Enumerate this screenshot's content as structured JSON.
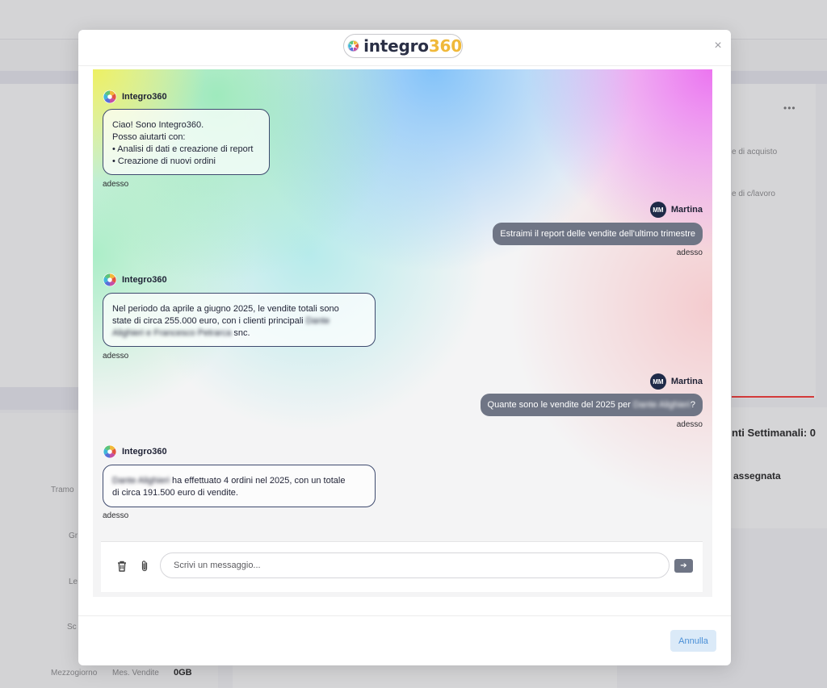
{
  "background": {
    "right_panel": {
      "line1": "e di acquisto",
      "line2": "e di c/lavoro"
    },
    "weekly_title": "nti Settimanali: 0",
    "assigned_label": "assegnata",
    "left_labels": [
      "Tramo",
      "Gr",
      "Le",
      "Sc"
    ],
    "bottom_row": {
      "c1": "Mezzogiorno",
      "c2": "Mes. Vendite",
      "c3": "0GB"
    }
  },
  "modal": {
    "logo": {
      "text_main": "integro",
      "text_accent": "360"
    },
    "close_symbol": "×",
    "messages": [
      {
        "sender": "bot",
        "author": "Integro360",
        "lines": [
          "Ciao! Sono Integro360.",
          "Posso aiutarti con:",
          "• Analisi di dati e creazione di report",
          "• Creazione di nuovi ordini"
        ],
        "time": "adesso"
      },
      {
        "sender": "user",
        "initials": "MM",
        "author": "Martina",
        "text": "Estraimi il report delle vendite dell'ultimo trimestre",
        "time": "adesso"
      },
      {
        "sender": "bot",
        "author": "Integro360",
        "line1": "Nel periodo da aprile a giugno 2025, le vendite totali sono",
        "line2": "state di circa 255.000 euro, con i clienti principali",
        "blurred_a": "Dante",
        "blurred_b": "Alighieri e Francesco Petrarca",
        "line3_end": "snc.",
        "time": "adesso"
      },
      {
        "sender": "user",
        "initials": "MM",
        "author": "Martina",
        "text_before": "Quante sono le vendite del 2025 per",
        "blurred": "Dante Alighieri",
        "text_after": "?",
        "time": "adesso"
      },
      {
        "sender": "bot",
        "author": "Integro360",
        "blurred": "Dante Alighieri",
        "line1_rest": "ha effettuato 4 ordini nel 2025, con un totale",
        "line2": "di circa 191.500 euro di vendite.",
        "time": "adesso"
      }
    ],
    "composer": {
      "placeholder": "Scrivi un messaggio...",
      "delete_icon": "trash-icon",
      "attach_icon": "paperclip-icon",
      "send_symbol": "➔"
    },
    "footer": {
      "cancel_label": "Annulla"
    }
  }
}
